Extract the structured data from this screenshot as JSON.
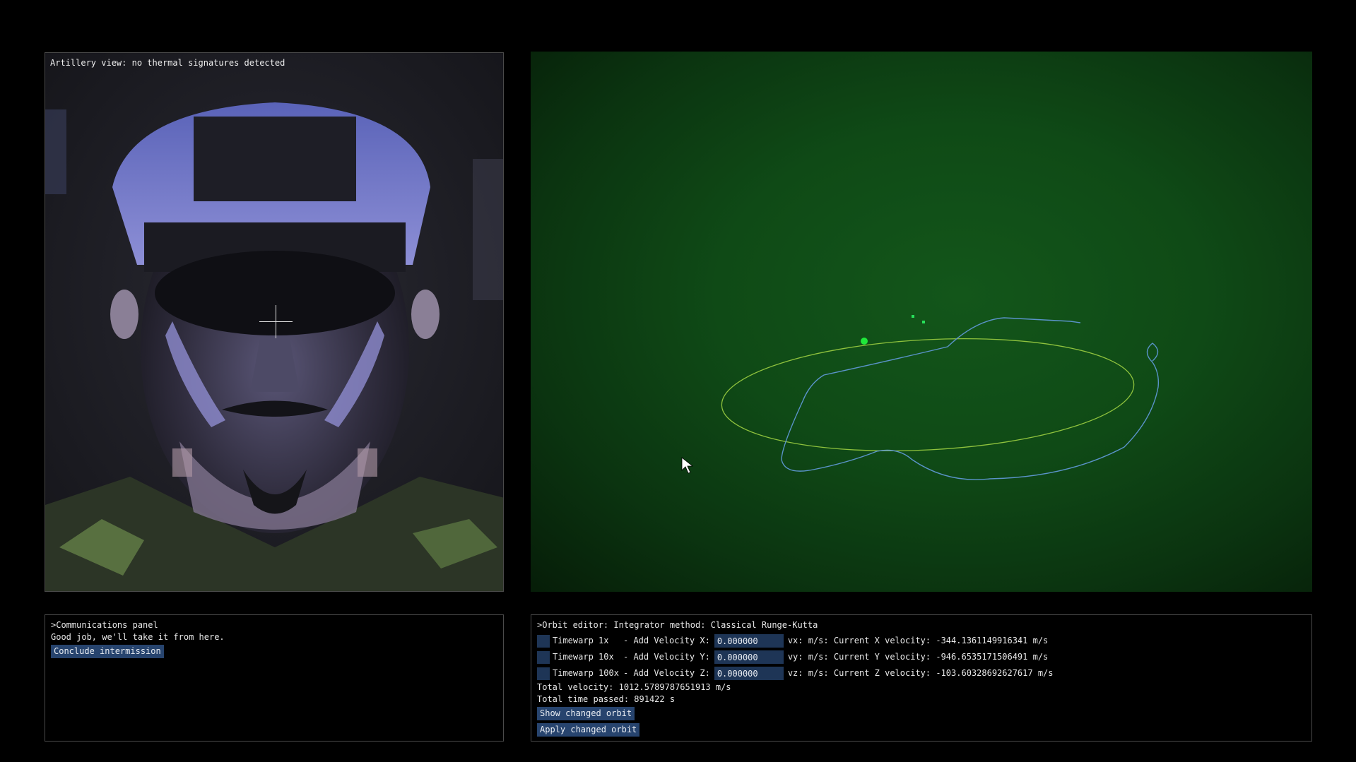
{
  "artillery": {
    "label": "Artillery view: no thermal signatures detected",
    "image_desc": "monster-face"
  },
  "comms": {
    "header": ">Communications panel",
    "message": "Good job, we'll take it from here.",
    "conclude_label": "Conclude intermission"
  },
  "orbit": {
    "header": ">Orbit editor: Integrator method: Classical Runge-Kutta",
    "rows": [
      {
        "timewarp_label": "Timewarp 1x",
        "add_label": "- Add Velocity X:",
        "value": "0.000000",
        "readout": "vx: m/s: Current X velocity: -344.1361149916341 m/s"
      },
      {
        "timewarp_label": "Timewarp 10x",
        "add_label": "- Add Velocity Y:",
        "value": "0.000000",
        "readout": "vy: m/s: Current Y velocity: -946.6535171506491 m/s"
      },
      {
        "timewarp_label": "Timewarp 100x",
        "add_label": "- Add Velocity Z:",
        "value": "0.000000",
        "readout": "vz: m/s: Current Z velocity: -103.60328692627617 m/s"
      }
    ],
    "total_velocity": "Total velocity: 1012.5789787651913 m/s",
    "total_time": "Total time passed: 891422 s",
    "show_label": "Show changed orbit",
    "apply_label": "Apply changed orbit"
  },
  "colors": {
    "button_bg": "#27446e",
    "field_bg": "#1e3556",
    "orbit_current": "#5a93c9",
    "orbit_changed": "#8fc23d",
    "planet": "#1fe83a"
  }
}
